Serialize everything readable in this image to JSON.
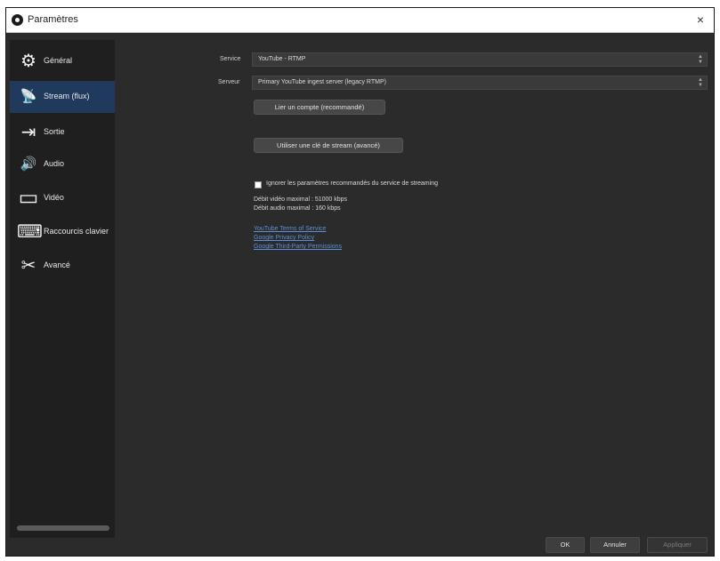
{
  "window": {
    "title": "Paramètres",
    "close": "×"
  },
  "sidebar": {
    "items": [
      {
        "label": "Général",
        "icon": "gear-icon",
        "glyph": "⚙"
      },
      {
        "label": "Stream (flux)",
        "icon": "broadcast-icon",
        "glyph": "📡"
      },
      {
        "label": "Sortie",
        "icon": "output-icon",
        "glyph": "⇥"
      },
      {
        "label": "Audio",
        "icon": "speaker-icon",
        "glyph": "🔊"
      },
      {
        "label": "Vidéo",
        "icon": "monitor-icon",
        "glyph": "▭"
      },
      {
        "label": "Raccourcis clavier",
        "icon": "keyboard-icon",
        "glyph": "⌨"
      },
      {
        "label": "Avancé",
        "icon": "tools-icon",
        "glyph": "✂"
      }
    ],
    "active_index": 1
  },
  "stream": {
    "service_label": "Service",
    "service_value": "YouTube - RTMP",
    "server_label": "Serveur",
    "server_value": "Primary YouTube ingest server (legacy RTMP)",
    "link_account_button": "Lier un compte (recommandé)",
    "use_stream_key_button": "Utiliser une clé de stream (avancé)",
    "ignore_checkbox_label": "Ignorer les paramètres recommandés du service de streaming",
    "max_video_bitrate": "Débit vidéo maximal : 51000 kbps",
    "max_audio_bitrate": "Débit audio maximal : 160 kbps",
    "links": [
      "YouTube Terms of Service",
      "Google Privacy Policy",
      "Google Third-Party Permissions"
    ]
  },
  "footer": {
    "ok": "OK",
    "cancel": "Annuler",
    "apply": "Appliquer"
  }
}
